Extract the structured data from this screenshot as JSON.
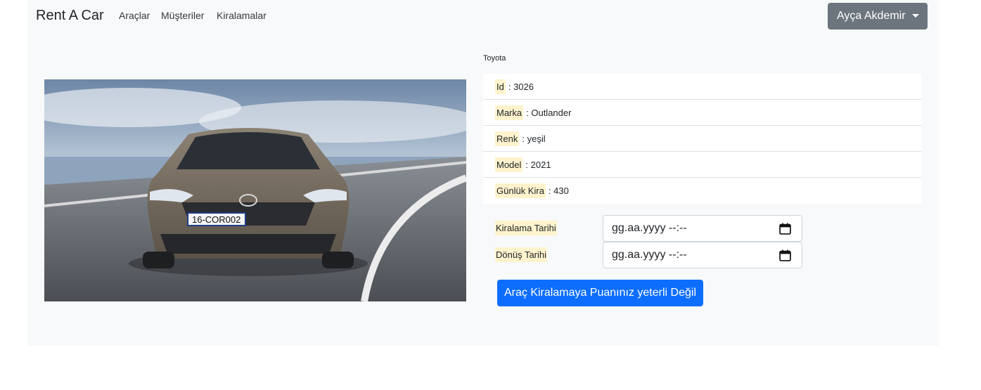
{
  "navbar": {
    "brand": "Rent A Car",
    "links": [
      "Araçlar",
      "Müşteriler",
      "Kiralamalar"
    ],
    "user": "Ayça Akdemir"
  },
  "car": {
    "brand_label": "Toyota",
    "plate": "16-COR002",
    "details": [
      {
        "key": "Id",
        "value": ": 3026"
      },
      {
        "key": "Marka",
        "value": ": Outlander"
      },
      {
        "key": "Renk",
        "value": ": yeşil"
      },
      {
        "key": "Model",
        "value": ": 2021"
      },
      {
        "key": "Günlük Kira",
        "value": ": 430"
      }
    ]
  },
  "form": {
    "rent_date_label": "Kiralama Tarihi",
    "rent_date_value": "gg.aa.yyyy --:--",
    "return_date_label": "Dönüş Tarihi",
    "return_date_value": "gg.aa.yyyy --:--",
    "submit_label": "Araç Kiralamaya Puanınız yeterli Değil"
  },
  "colors": {
    "panel_bg": "#f8f9fa",
    "primary": "#0d6efd",
    "secondary": "#6c757d",
    "highlight": "#fff3cd"
  }
}
